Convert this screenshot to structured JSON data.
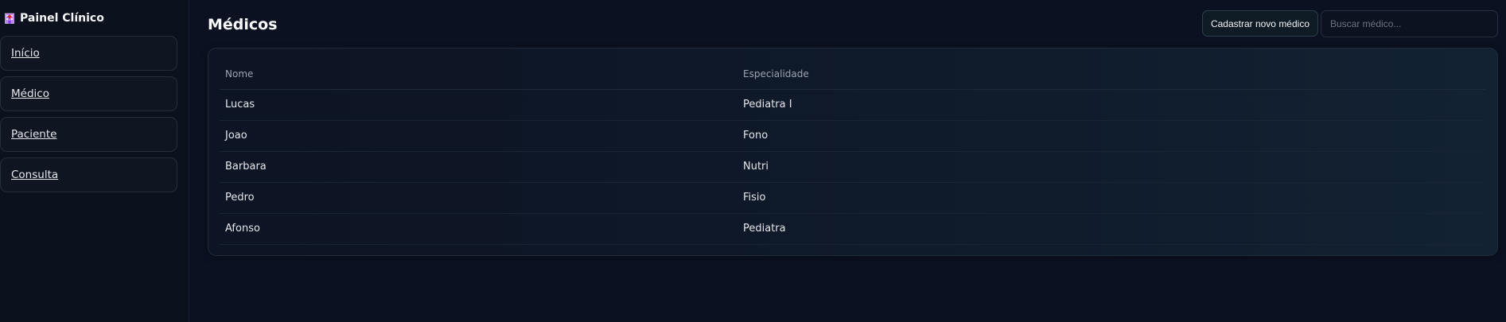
{
  "sidebar": {
    "brand": "Painel Clínico",
    "brand_icon": "hospital-icon",
    "items": [
      {
        "label": "Início"
      },
      {
        "label": "Médico"
      },
      {
        "label": "Paciente"
      },
      {
        "label": "Consulta"
      }
    ]
  },
  "header": {
    "title": "Médicos",
    "add_button": "Cadastrar novo médico",
    "search_placeholder": "Buscar médico..."
  },
  "table": {
    "columns": [
      "Nome",
      "Especialidade"
    ],
    "rows": [
      {
        "nome": "Lucas",
        "especialidade": "Pediatra I"
      },
      {
        "nome": "Joao",
        "especialidade": "Fono"
      },
      {
        "nome": "Barbara",
        "especialidade": "Nutri"
      },
      {
        "nome": "Pedro",
        "especialidade": "Fisio"
      },
      {
        "nome": "Afonso",
        "especialidade": "Pediatra"
      }
    ]
  },
  "colors": {
    "background": "#0b1120",
    "sidebar": "#0c121d",
    "text": "#e5e7eb",
    "muted": "#9ca3af"
  }
}
